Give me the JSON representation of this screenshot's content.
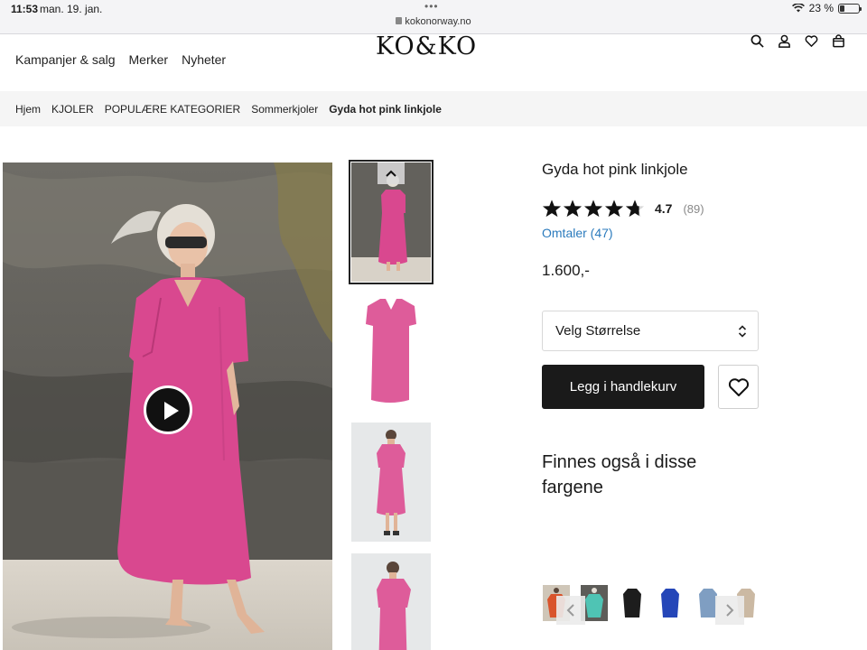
{
  "status_bar": {
    "time": "11:53",
    "date": "man. 19. jan.",
    "url": "kokonorway.no",
    "battery": "23 %",
    "battery_level": 0.23
  },
  "header": {
    "logo": "KO&KO",
    "nav": [
      "Kampanjer & salg",
      "Merker",
      "Nyheter"
    ],
    "icons": [
      "search-icon",
      "user-icon",
      "heart-icon",
      "bag-icon"
    ]
  },
  "breadcrumb": {
    "items": [
      "Hjem",
      "KJOLER",
      "POPULÆRE KATEGORIER",
      "Sommerkjoler"
    ],
    "current": "Gyda hot pink linkjole"
  },
  "product": {
    "title": "Gyda hot pink linkjole",
    "rating": 4.7,
    "rating_value": "4.7",
    "rating_count": "(89)",
    "reviews_link": "Omtaler (47)",
    "price": "1.600,-",
    "size_select": "Velg Størrelse",
    "add_to_cart": "Legg i handlekurv",
    "colors_title": "Finnes også i disse fargene"
  },
  "colors": {
    "accent": "#1a1a1a",
    "link": "#2b7bbd",
    "dress_pink": "#d9488f",
    "swatches": [
      "#d9542c",
      "#4fc4b4",
      "#1d1d1d",
      "#2546b8",
      "#7f9ec2",
      "#cbb9a3"
    ]
  }
}
